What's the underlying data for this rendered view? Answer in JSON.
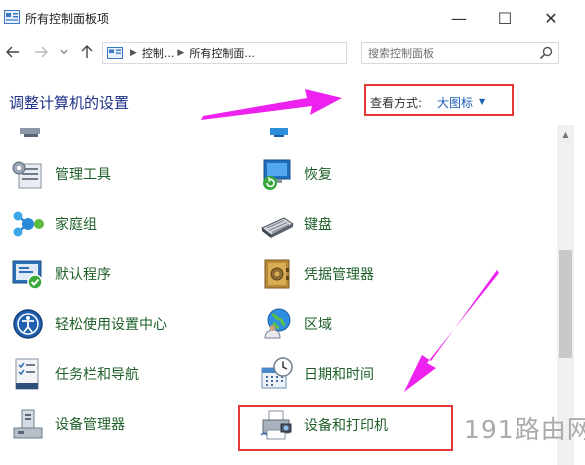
{
  "window": {
    "title": "所有控制面板项",
    "controls": {
      "minimize": "—",
      "maximize": "☐",
      "close": "✕"
    }
  },
  "navigation": {
    "breadcrumbs": [
      "控制...",
      "所有控制面..."
    ],
    "search_placeholder": "搜索控制面板"
  },
  "header": {
    "title": "调整计算机的设置",
    "view_by_label": "查看方式:",
    "view_by_value": "大图标"
  },
  "items_left": [
    {
      "label": "管理工具",
      "icon": "admin-tools-icon"
    },
    {
      "label": "家庭组",
      "icon": "homegroup-icon"
    },
    {
      "label": "默认程序",
      "icon": "default-programs-icon"
    },
    {
      "label": "轻松使用设置中心",
      "icon": "ease-of-access-icon"
    },
    {
      "label": "任务栏和导航",
      "icon": "taskbar-icon"
    },
    {
      "label": "设备管理器",
      "icon": "device-manager-icon"
    }
  ],
  "items_right": [
    {
      "label": "恢复",
      "icon": "recovery-icon"
    },
    {
      "label": "键盘",
      "icon": "keyboard-icon"
    },
    {
      "label": "凭据管理器",
      "icon": "credential-manager-icon"
    },
    {
      "label": "区域",
      "icon": "region-icon"
    },
    {
      "label": "日期和时间",
      "icon": "date-time-icon"
    },
    {
      "label": "设备和打印机",
      "icon": "devices-printers-icon"
    }
  ],
  "annotation_colors": {
    "arrow": "#ee22ee",
    "highlight": "#e53935"
  },
  "watermark": "191路由网"
}
